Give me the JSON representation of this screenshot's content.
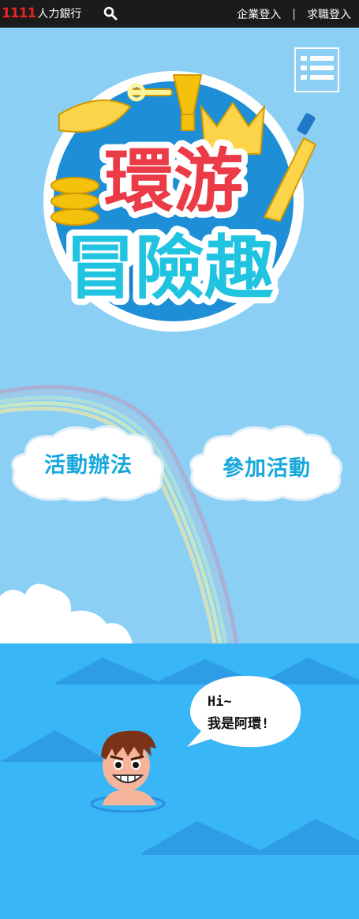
{
  "header": {
    "brand_number": "1111",
    "brand_name": "人力銀行",
    "search_icon": "search-icon",
    "links": [
      "企業登入",
      "求職登入"
    ],
    "separator": "|"
  },
  "logo": {
    "line1": "環游",
    "line2": "冒險趣"
  },
  "menu": {
    "icon": "hamburger-menu-icon"
  },
  "buttons": {
    "rules": "活動辦法",
    "join": "參加活動"
  },
  "speech": {
    "line1": "Hi~",
    "line2": "我是阿環!"
  },
  "colors": {
    "sky": "#8ccff5",
    "sea": "#38b6f6",
    "topbar": "#1b1b1b",
    "brand_red": "#e52421",
    "button_text": "#16a8dc",
    "logo_red": "#ea3b47",
    "logo_cyan": "#21c4e0"
  }
}
